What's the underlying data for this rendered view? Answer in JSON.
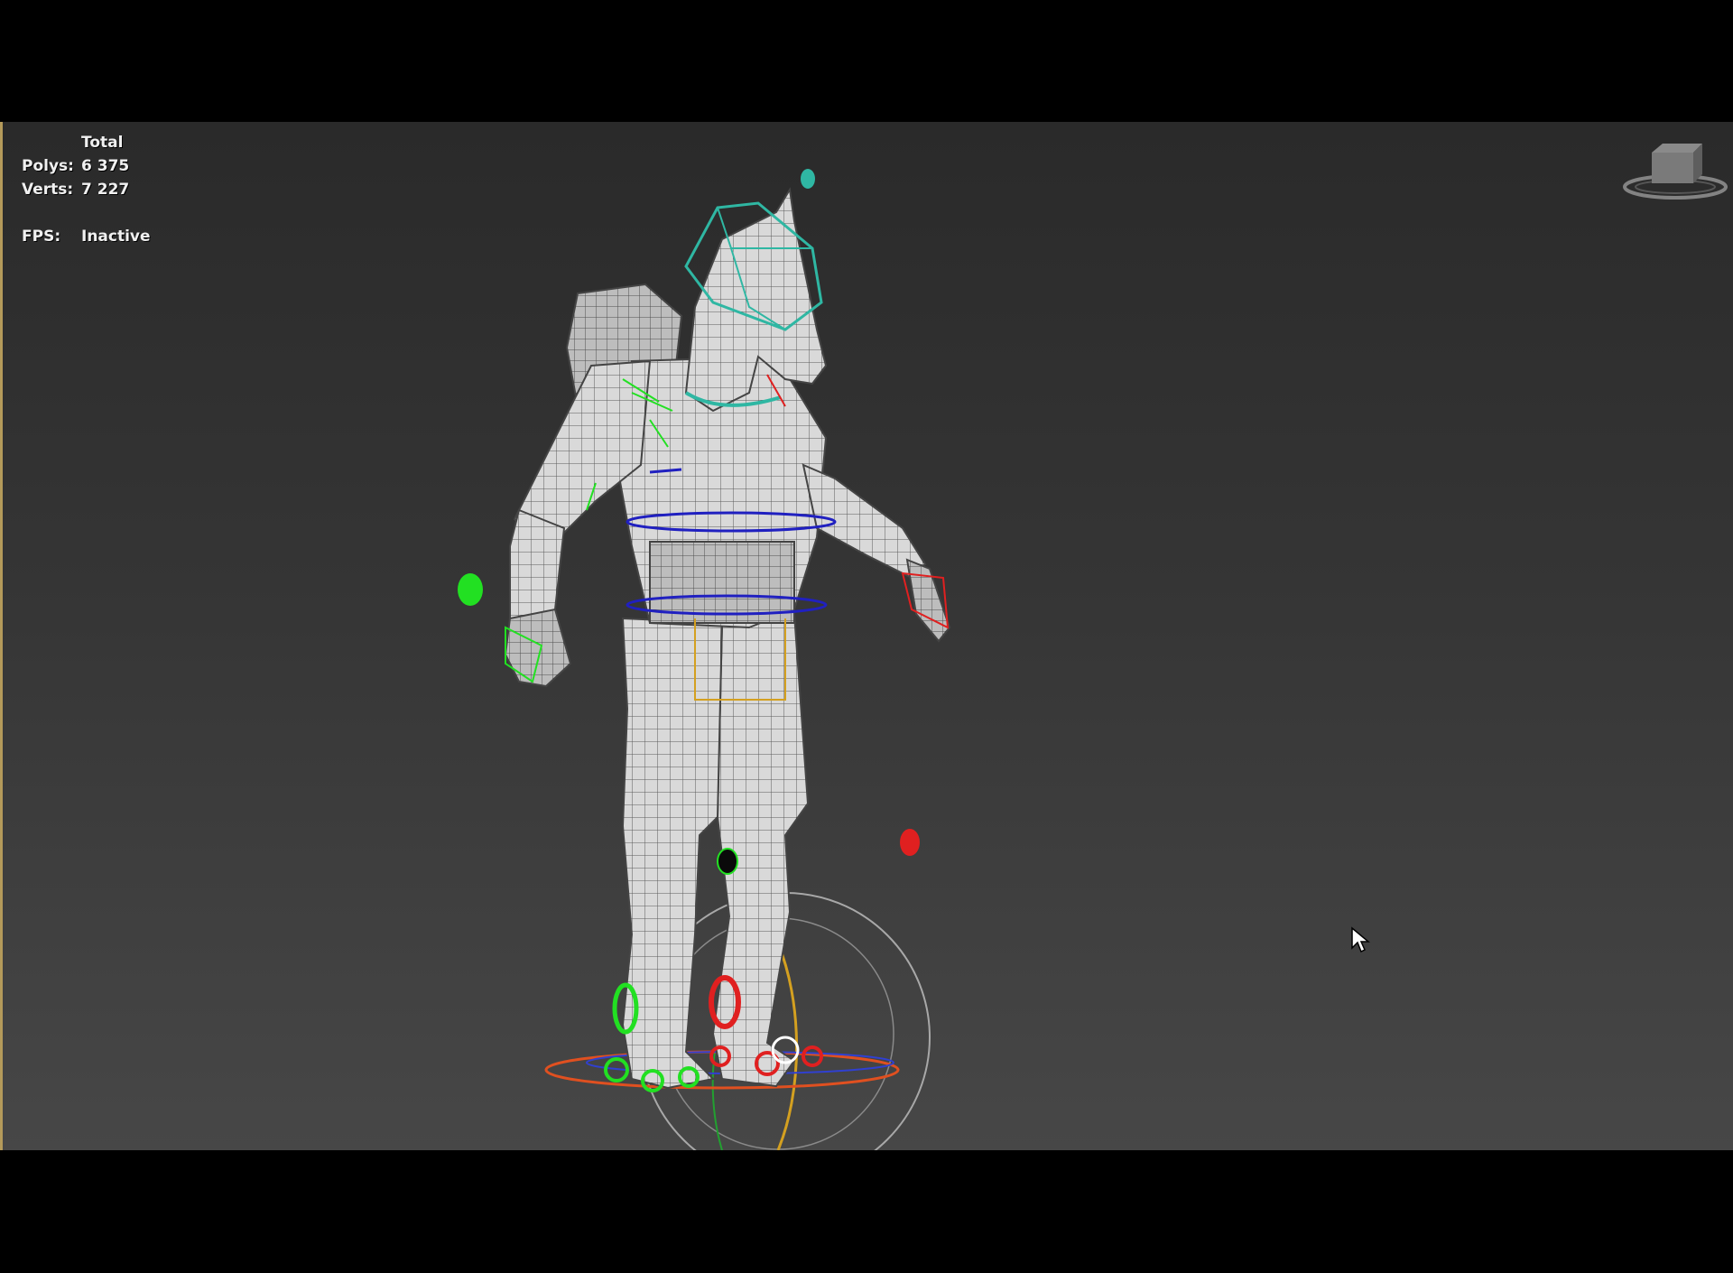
{
  "stats": {
    "header": "Total",
    "polys_label": "Polys:",
    "polys_value": "6 375",
    "verts_label": "Verts:",
    "verts_value": "7 227",
    "fps_label": "FPS:",
    "fps_value": "Inactive"
  },
  "icons": {
    "viewcube": "viewcube-icon",
    "cursor": "mouse-pointer-icon"
  },
  "colors": {
    "viewport_top": "#2a2a2a",
    "viewport_bottom": "#474747",
    "active_viewport_border": "#b49a5a",
    "head_control": "#2fb7a3",
    "left_side_controls": "#22e022",
    "right_side_controls": "#e02020",
    "spine_controls": "#2020c0",
    "hip_control": "#d4a020"
  }
}
